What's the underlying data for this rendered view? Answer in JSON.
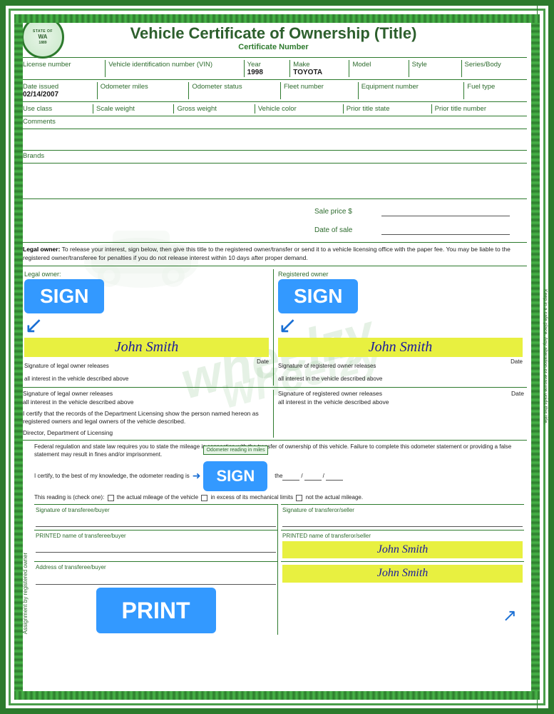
{
  "header": {
    "state": "STATE OF WASHINGTON",
    "title": "Vehicle Certificate of Ownership (Title)",
    "cert_label": "Certificate Number"
  },
  "seal": {
    "label": "STATE OF WASHINGTON 1889"
  },
  "fields": {
    "row1": [
      {
        "label": "License number",
        "value": ""
      },
      {
        "label": "Vehicle identification number (VIN)",
        "value": ""
      },
      {
        "label": "Year",
        "value": "1998"
      },
      {
        "label": "Make",
        "value": "TOYOTA"
      },
      {
        "label": "Model",
        "value": ""
      },
      {
        "label": "Style",
        "value": ""
      },
      {
        "label": "Series/Body",
        "value": ""
      }
    ],
    "row2": [
      {
        "label": "Date issued",
        "value": "02/14/2007"
      },
      {
        "label": "Odometer miles",
        "value": ""
      },
      {
        "label": "Odometer status",
        "value": ""
      },
      {
        "label": "Fleet number",
        "value": ""
      },
      {
        "label": "Equipment number",
        "value": ""
      },
      {
        "label": "Fuel type",
        "value": ""
      }
    ],
    "row3": [
      {
        "label": "Use class",
        "value": ""
      },
      {
        "label": "Scale weight",
        "value": ""
      },
      {
        "label": "Gross weight",
        "value": ""
      },
      {
        "label": "Vehicle color",
        "value": ""
      },
      {
        "label": "Prior title state",
        "value": ""
      },
      {
        "label": "Prior title number",
        "value": ""
      }
    ]
  },
  "comments_label": "Comments",
  "brands_label": "Brands",
  "sale": {
    "price_label": "Sale price $",
    "date_label": "Date of sale"
  },
  "legal": {
    "bold_part": "Legal owner:",
    "text": " To release your interest, sign below, then give this title to the registered owner/transfer or send it to a vehicle licensing office with the paper fee. You may be liable to the registered owner/transferee for penalties if you do not release interest within 10 days after proper demand."
  },
  "signatures": {
    "legal_owner_label": "Legal owner:",
    "registered_owner_label": "Registered owner",
    "sign_label": "SIGN",
    "name1": "John Smith",
    "name2": "John Smith",
    "sig_legal_sub1": "Signature of legal owner releases",
    "sig_legal_sub2": "all interest in the vehicle described above",
    "sig_reg_sub1": "Signature of registered owner releases",
    "sig_reg_sub2": "all interest in the vehicle described above",
    "date_label": "Date"
  },
  "cert_row": {
    "left1": "Signature of legal owner releases",
    "left2": "all interest in the vehicle described above",
    "cert_text": "I certify that the records of the Department Licensing show the person named hereon as registered owners and legal owners of the vehicle described.",
    "director_label": "Director, Department of Licensing",
    "right1": "Signature of registered owner releases",
    "right2": "all interest in the vehicle described above",
    "date_label": "Date"
  },
  "assignment": {
    "vert_label": "Assignment by registered owner",
    "fed_text": "Federal regulation and state law requires you to state the mileage in connection with the transfer of ownership of this vehicle. Failure to complete this odometer statement or providing a false statement may result in fines and/or imprisonment.",
    "certify_text": "I certify, to the best of my knowledge, the odometer reading is",
    "reading_label": "Odometer reading in miles",
    "check_text": "This reading is (check one):",
    "check1": "the actual mileage of the vehicle",
    "check2": "in excess of its mechanical limits",
    "check3": "not the actual mileage.",
    "sig_buyer_label": "Signature of transferee/buyer",
    "sig_seller_label": "Signature of transferor/seller",
    "print_buyer_label": "PRINTED name of transferee/buyer",
    "print_seller_label": "PRINTED name of transferor/seller",
    "address_buyer_label": "Address of transferee/buyer",
    "name_seller": "John Smith",
    "name_seller2": "John Smith"
  },
  "sign_button": "SIGN",
  "print_button": "PRINT",
  "watermark": "wheelzy",
  "right_side_bar1": "Keep in a safe place. Any alteration or erasure voids this title."
}
